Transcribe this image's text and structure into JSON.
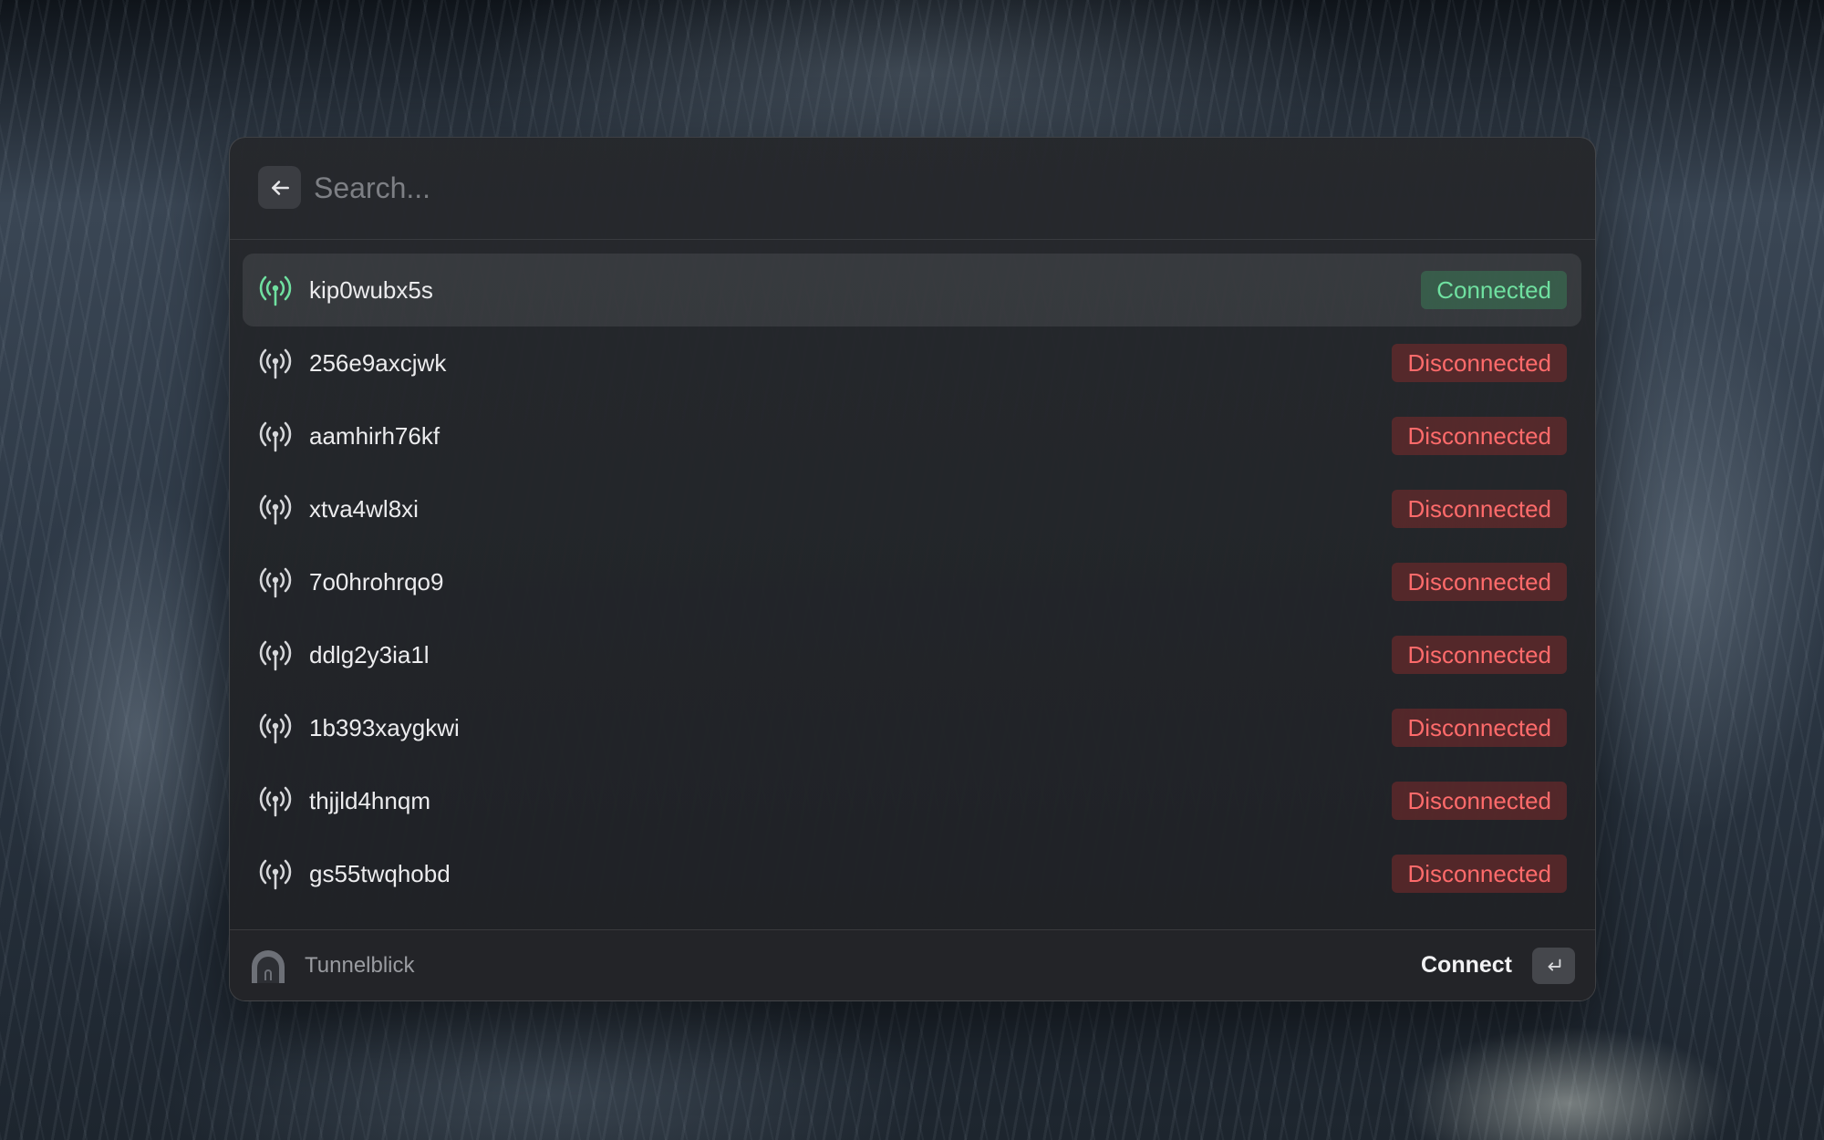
{
  "search": {
    "placeholder": "Search...",
    "back_icon": "arrow-left-icon"
  },
  "items": [
    {
      "name": "kip0wubx5s",
      "status": "Connected",
      "state": "connected",
      "selected": true
    },
    {
      "name": "256e9axcjwk",
      "status": "Disconnected",
      "state": "disconnected"
    },
    {
      "name": "aamhirh76kf",
      "status": "Disconnected",
      "state": "disconnected"
    },
    {
      "name": "xtva4wl8xi",
      "status": "Disconnected",
      "state": "disconnected"
    },
    {
      "name": "7o0hrohrqo9",
      "status": "Disconnected",
      "state": "disconnected"
    },
    {
      "name": "ddlg2y3ia1l",
      "status": "Disconnected",
      "state": "disconnected"
    },
    {
      "name": "1b393xaygkwi",
      "status": "Disconnected",
      "state": "disconnected"
    },
    {
      "name": "thjjld4hnqm",
      "status": "Disconnected",
      "state": "disconnected"
    },
    {
      "name": "gs55twqhobd",
      "status": "Disconnected",
      "state": "disconnected"
    }
  ],
  "footer": {
    "app_name": "Tunnelblick",
    "action_label": "Connect",
    "shortcut_icon": "return-key-icon"
  },
  "colors": {
    "connected": "#6fe0a0",
    "disconnected": "#ff6b6b",
    "icon_default": "#d6d7da"
  }
}
